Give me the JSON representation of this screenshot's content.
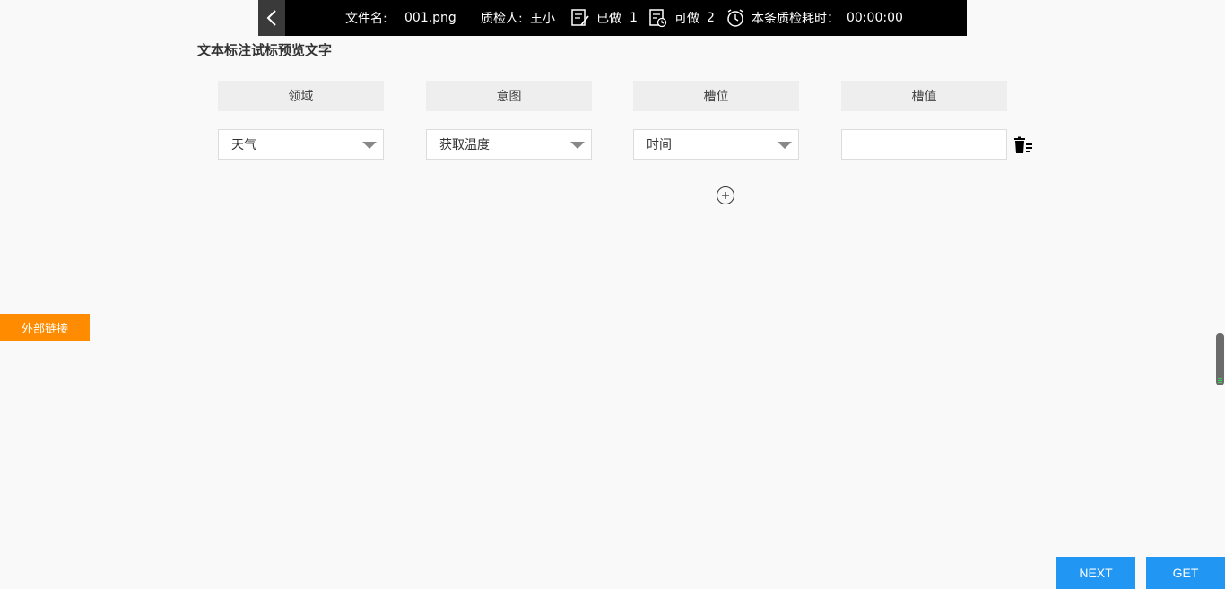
{
  "topbar": {
    "file_label": "文件名:",
    "file_name": "001.png",
    "inspector_label": "质检人:",
    "inspector_name": "王小",
    "done_label": "已做",
    "done_count": "1",
    "todo_label": "可做",
    "todo_count": "2",
    "time_label": "本条质检耗时：",
    "time_value": "00:00:00"
  },
  "page_title": "文本标注试标预览文字",
  "columns": [
    "领域",
    "意图",
    "槽位",
    "槽值"
  ],
  "row": {
    "domain": "天气",
    "intent": "获取温度",
    "slot": "时间",
    "slot_value": ""
  },
  "sidebar": {
    "external_link": "外部链接"
  },
  "buttons": {
    "next": "NEXT",
    "get": "GET"
  },
  "colors": {
    "accent_blue": "#2196f3",
    "accent_orange": "#ff8c00",
    "topbar_bg": "#000000"
  },
  "icons": [
    "chevron-left-icon",
    "edit-doc-icon",
    "doc-clock-icon",
    "alarm-clock-icon",
    "trash-list-icon",
    "plus-circle-icon"
  ]
}
